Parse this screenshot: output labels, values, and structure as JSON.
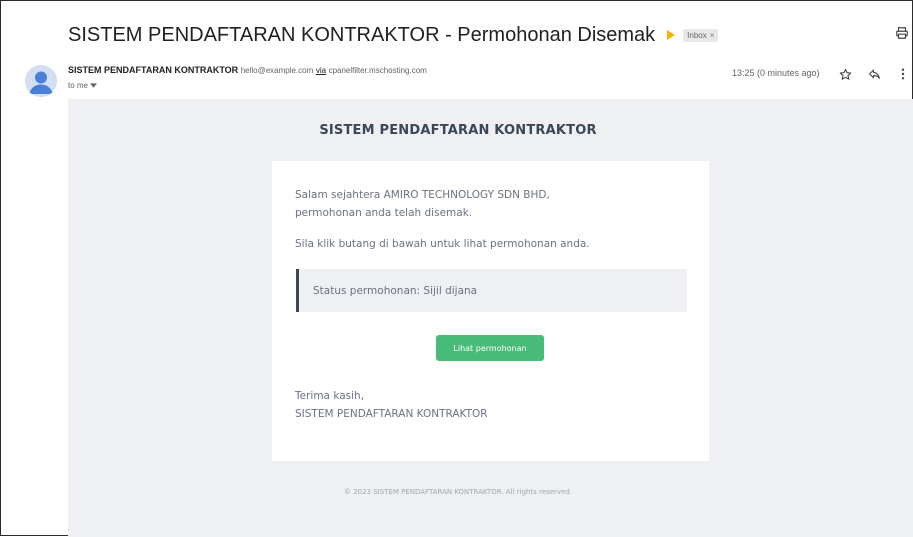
{
  "subject": {
    "title": "SISTEM PENDAFTARAN KONTRAKTOR - Permohonan Disemak",
    "label": "Inbox",
    "label_close": "×"
  },
  "sender": {
    "name": "SISTEM PENDAFTARAN KONTRAKTOR",
    "email": "hello@example.com",
    "via_label": "via",
    "via_host": "cpanelfilter.mschosting.com",
    "to_label": "to me",
    "timestamp": "13:25 (0 minutes ago)"
  },
  "icons": {
    "print": "printer-icon",
    "star": "star-icon",
    "reply": "reply-icon",
    "more": "more-vertical-icon",
    "avatar": "person-icon",
    "importance": "importance-marker-icon"
  },
  "email": {
    "brand_title": "SISTEM PENDAFTARAN KONTRAKTOR",
    "greeting": "Salam sejahtera AMIRO TECHNOLOGY SDN BHD,",
    "line2": "permohonan anda telah disemak.",
    "instruction": "Sila klik butang di bawah untuk lihat permohonan anda.",
    "status": "Status permohonan: Sijil dijana",
    "button_label": "Lihat permohonan",
    "closing": "Terima kasih,",
    "signature": "SISTEM PENDAFTARAN KONTRAKTOR",
    "footer": "© 2023 SISTEM PENDAFTARAN KONTRAKTOR. All rights reserved."
  },
  "colors": {
    "button": "#48bb78",
    "email_background": "#eef0f3",
    "accent_bar": "#3b4656",
    "importance": "#f4b400"
  }
}
